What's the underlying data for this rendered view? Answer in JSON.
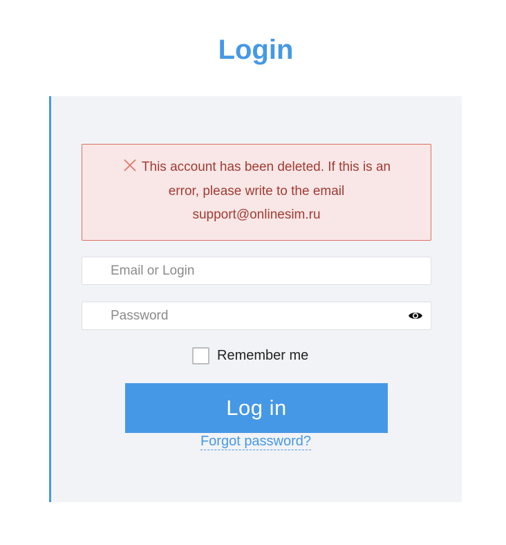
{
  "page": {
    "title": "Login"
  },
  "alert": {
    "icon": "close-icon",
    "line1": "This account has been deleted. If this is an",
    "line2": "error, please write to the email",
    "line3": "support@onlinesim.ru"
  },
  "form": {
    "login_placeholder": "Email or Login",
    "login_value": "",
    "password_placeholder": "Password",
    "password_value": "",
    "password_toggle_icon": "eye-icon",
    "remember_label": "Remember me",
    "remember_checked": false,
    "submit_label": "Log in",
    "forgot_label": "Forgot password?"
  },
  "colors": {
    "accent": "#4598e6",
    "panel_bg": "#f2f3f7",
    "alert_bg": "#f8e7e6",
    "alert_border": "#dc7060",
    "alert_text": "#a23a34"
  }
}
